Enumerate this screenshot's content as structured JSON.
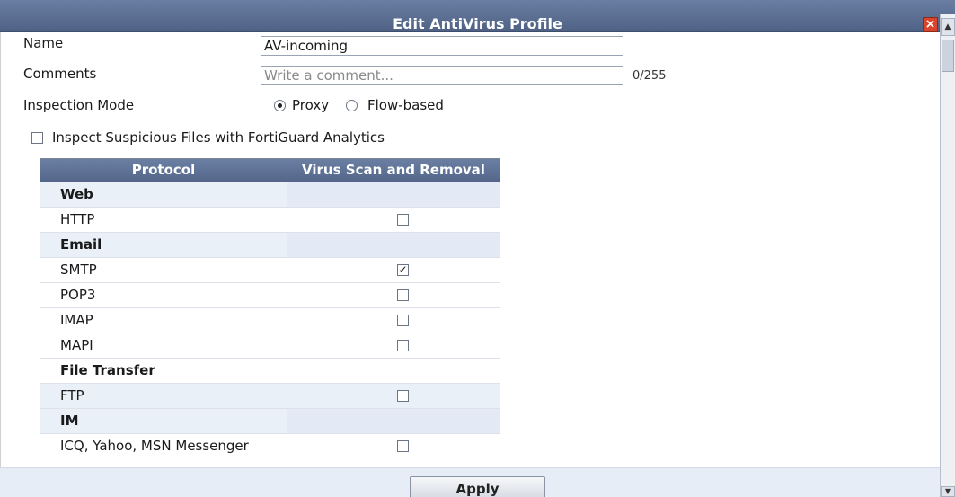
{
  "dialog": {
    "title": "Edit AntiVirus Profile",
    "close_symbol": "×"
  },
  "form": {
    "name_label": "Name",
    "name_value": "AV-incoming",
    "comments_label": "Comments",
    "comments_placeholder": "Write a comment...",
    "comments_counter": "0/255",
    "inspection_label": "Inspection Mode",
    "mode_options": [
      {
        "label": "Proxy",
        "selected": true
      },
      {
        "label": "Flow-based",
        "selected": false
      }
    ],
    "fortiguard_label": "Inspect Suspicious Files with FortiGuard Analytics",
    "fortiguard_checked": false
  },
  "table": {
    "headers": [
      "Protocol",
      "Virus Scan and Removal"
    ],
    "rows": [
      {
        "label": "Web",
        "type": "group"
      },
      {
        "label": "HTTP",
        "type": "item",
        "checked": false
      },
      {
        "label": "Email",
        "type": "group"
      },
      {
        "label": "SMTP",
        "type": "item",
        "checked": true
      },
      {
        "label": "POP3",
        "type": "item",
        "checked": false
      },
      {
        "label": "IMAP",
        "type": "item",
        "checked": false
      },
      {
        "label": "MAPI",
        "type": "item",
        "checked": false
      },
      {
        "label": "File Transfer",
        "type": "group"
      },
      {
        "label": "FTP",
        "type": "item",
        "checked": false
      },
      {
        "label": "IM",
        "type": "group"
      },
      {
        "label": "ICQ, Yahoo, MSN Messenger",
        "type": "item",
        "checked": false
      }
    ]
  },
  "footer": {
    "apply_label": "Apply"
  },
  "colors": {
    "titlebar": "#5a6d91",
    "group_row": "#eaf0f8",
    "close": "#d9442b"
  },
  "icons": [
    "close-icon",
    "scroll-up-arrow-icon",
    "scroll-down-arrow-icon",
    "checkmark-icon"
  ]
}
